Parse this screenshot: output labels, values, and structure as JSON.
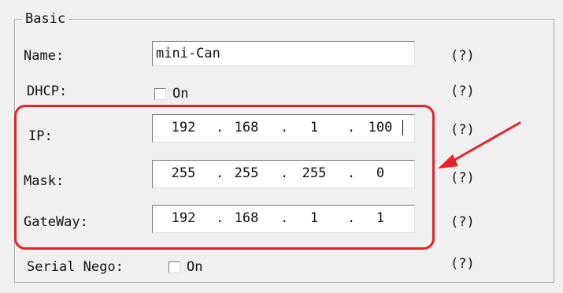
{
  "group": {
    "title": "Basic"
  },
  "fields": {
    "name": {
      "label": "Name:",
      "value": "mini-Can",
      "help": "(?)"
    },
    "dhcp": {
      "label": "DHCP:",
      "checkbox_label": "On",
      "checked": false,
      "help": "(?)"
    },
    "ip": {
      "label": "IP:",
      "octets": [
        "192",
        "168",
        "1",
        "100"
      ],
      "help": "(?)"
    },
    "mask": {
      "label": "Mask:",
      "octets": [
        "255",
        "255",
        "255",
        "0"
      ],
      "help": "(?)"
    },
    "gateway": {
      "label": "GateWay:",
      "octets": [
        "192",
        "168",
        "1",
        "1"
      ],
      "help": "(?)"
    },
    "serial_nego": {
      "label": "Serial Nego:",
      "checkbox_label": "On",
      "checked": false,
      "help": "(?)"
    }
  },
  "dot": ".",
  "colors": {
    "annotation_red": "#e8212a",
    "panel_bg": "#f0f0f0"
  }
}
